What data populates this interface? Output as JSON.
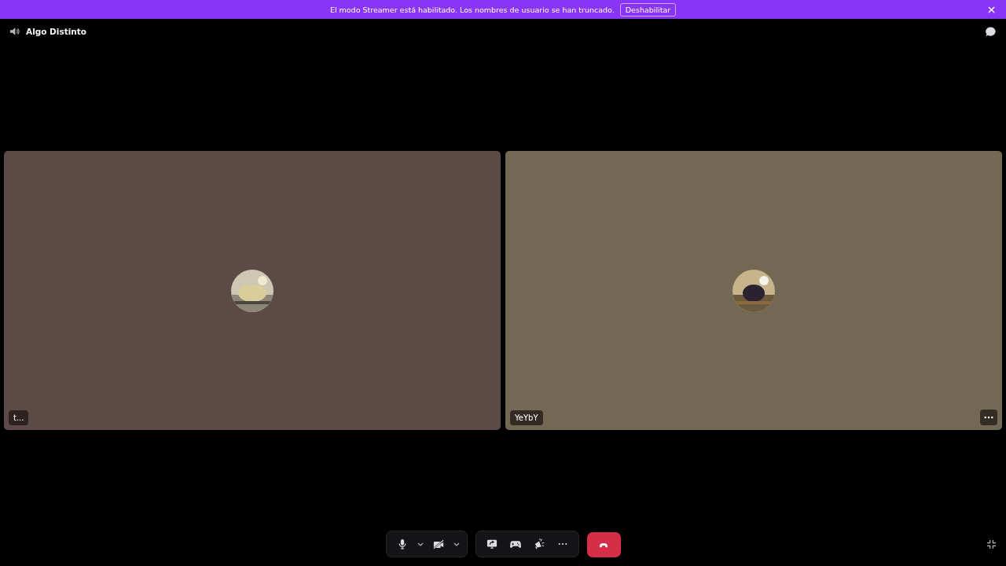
{
  "banner": {
    "message": "El modo Streamer está habilitado. Los nombres de usuario se han truncado.",
    "button": "Deshabilitar"
  },
  "channel": {
    "name": "Algo Distinto"
  },
  "tiles": [
    {
      "name": "t...",
      "color": "#5b4a46",
      "show_menu": false
    },
    {
      "name": "YeYbY",
      "color": "#736853",
      "show_menu": true
    }
  ],
  "controls": {
    "mic_on": true,
    "camera_on": false
  }
}
